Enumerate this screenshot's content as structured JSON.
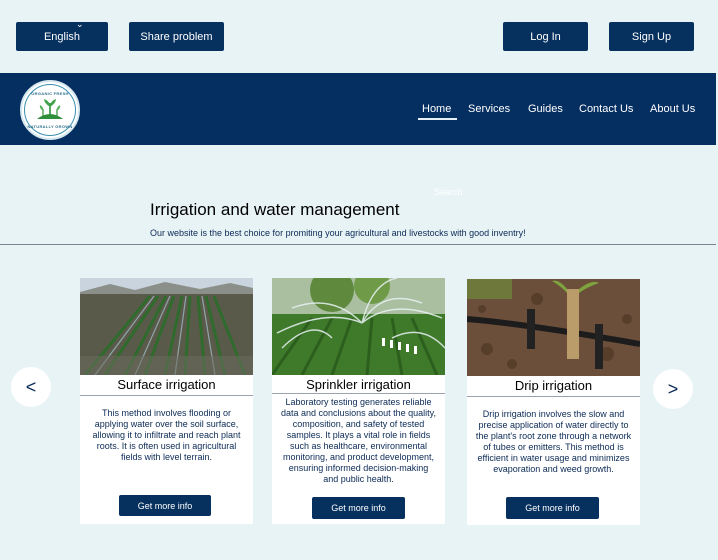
{
  "topbar": {
    "language_label": "English",
    "share_label": "Share problem",
    "login_label": "Log In",
    "signup_label": "Sign Up",
    "language_caret_icon": "chevron-down-icon"
  },
  "logo": {
    "text_top": "ORGANIC FRESH",
    "text_bottom": "NATURALLY GROWN",
    "icon": "plant-icon"
  },
  "nav": {
    "items": [
      {
        "label": "Home",
        "active": true
      },
      {
        "label": "Services"
      },
      {
        "label": "Guides"
      },
      {
        "label": "Contact Us"
      },
      {
        "label": "About Us"
      }
    ]
  },
  "search": {
    "label": "Search"
  },
  "hero": {
    "title": "Irrigation and water management",
    "subtitle": "Our website is the best choice for promiting your agricultural and livestocks with good inventry!"
  },
  "carousel": {
    "prev_label": "<",
    "next_label": ">",
    "cards": [
      {
        "title": "Surface irrigation",
        "description": "This method involves flooding or applying water over the soil surface, allowing it to infiltrate and reach plant roots. It is often used in agricultural fields with level terrain.",
        "button": "Get more info",
        "image": "field-furrows-image"
      },
      {
        "title": "Sprinkler irrigation",
        "description": "Laboratory testing generates reliable data and conclusions about the quality, composition, and safety of tested samples. It plays a vital role in fields such as healthcare, environmental monitoring, and product development, ensuring informed decision-making and public health.",
        "button": "Get more info",
        "image": "sprinkler-field-image"
      },
      {
        "title": "Drip irrigation",
        "description": "Drip irrigation involves the slow and precise application of water directly to the plant's root zone through a network of tubes or emitters. This method is efficient in water usage and minimizes evaporation and weed growth.",
        "button": "Get more info",
        "image": "drip-emitter-image"
      }
    ]
  },
  "colors": {
    "page_bg": "#e8f3f6",
    "navy": "#052e61",
    "button_navy": "#06305e"
  }
}
